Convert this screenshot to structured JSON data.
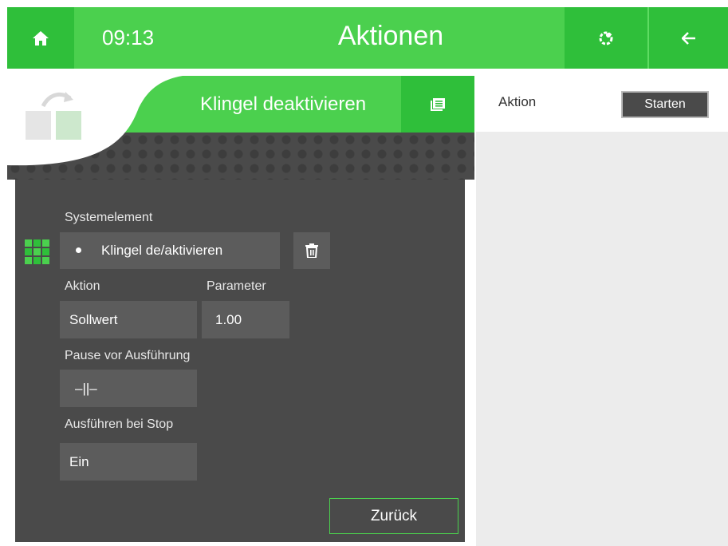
{
  "header": {
    "time": "09:13",
    "title": "Aktionen"
  },
  "page": {
    "heading": "Klingel deaktivieren"
  },
  "right_panel": {
    "aktion_label": "Aktion",
    "start_button": "Starten"
  },
  "form": {
    "systemelement_label": "Systemelement",
    "systemelement_value": "Klingel de/aktivieren",
    "aktion_label": "Aktion",
    "aktion_value": "Sollwert",
    "parameter_label": "Parameter",
    "parameter_value": "1.00",
    "pause_label": "Pause vor Ausführung",
    "pause_value": "–||–",
    "stop_label": "Ausführen bei Stop",
    "stop_value": "Ein",
    "back_button": "Zurück"
  },
  "colors": {
    "green": "#4bd04e",
    "dark_green": "#2fbf3a",
    "panel": "#4a4a4a",
    "field": "#5c5c5c"
  },
  "icons": [
    "home-icon",
    "settings-gear-icon",
    "back-arrow-icon",
    "list-icon",
    "copy-action-icon",
    "grid-icon",
    "trash-icon"
  ]
}
